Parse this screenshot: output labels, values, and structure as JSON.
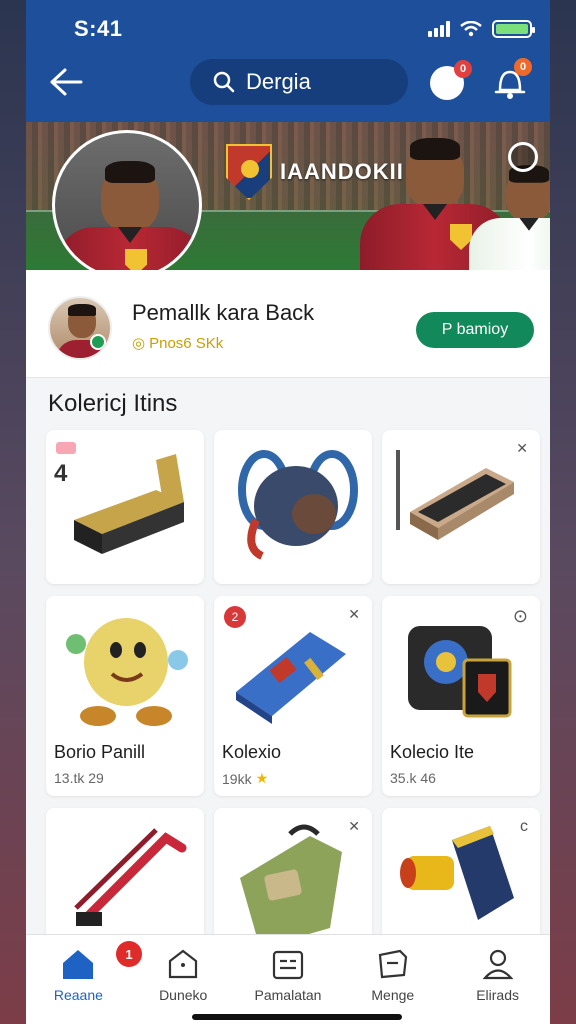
{
  "status": {
    "time": "S:41"
  },
  "header": {
    "search_text": "Dergia",
    "avatar_badge": "0",
    "bell_badge": "0"
  },
  "banner": {
    "title": "IAANDOKII"
  },
  "profile": {
    "name": "Pemallk kara Back",
    "stat": "Pnos6 SKk",
    "button": "P bamioy"
  },
  "collection": {
    "title": "Kolericj Itins",
    "items": [
      {
        "name": "",
        "stat": "",
        "badge_text": "4"
      },
      {
        "name": "",
        "stat": ""
      },
      {
        "name": "",
        "stat": ""
      },
      {
        "name": "Borio Panill",
        "stat": "13.tk 29"
      },
      {
        "name": "Kolexio",
        "stat": "19kk",
        "badge": "2"
      },
      {
        "name": "Kolecio Ite",
        "stat": "35.k 46"
      },
      {
        "name": "",
        "stat": ""
      },
      {
        "name": "",
        "stat": ""
      },
      {
        "name": "",
        "stat": ""
      }
    ]
  },
  "nav": {
    "items": [
      {
        "label": "Reaane"
      },
      {
        "label": "Duneko"
      },
      {
        "label": "Pamalatan"
      },
      {
        "label": "Menge"
      },
      {
        "label": "Elirads"
      }
    ],
    "badge": "1"
  },
  "colors": {
    "header": "#1e4f9a",
    "accent": "#12895a",
    "nav_active": "#1e63c4"
  }
}
